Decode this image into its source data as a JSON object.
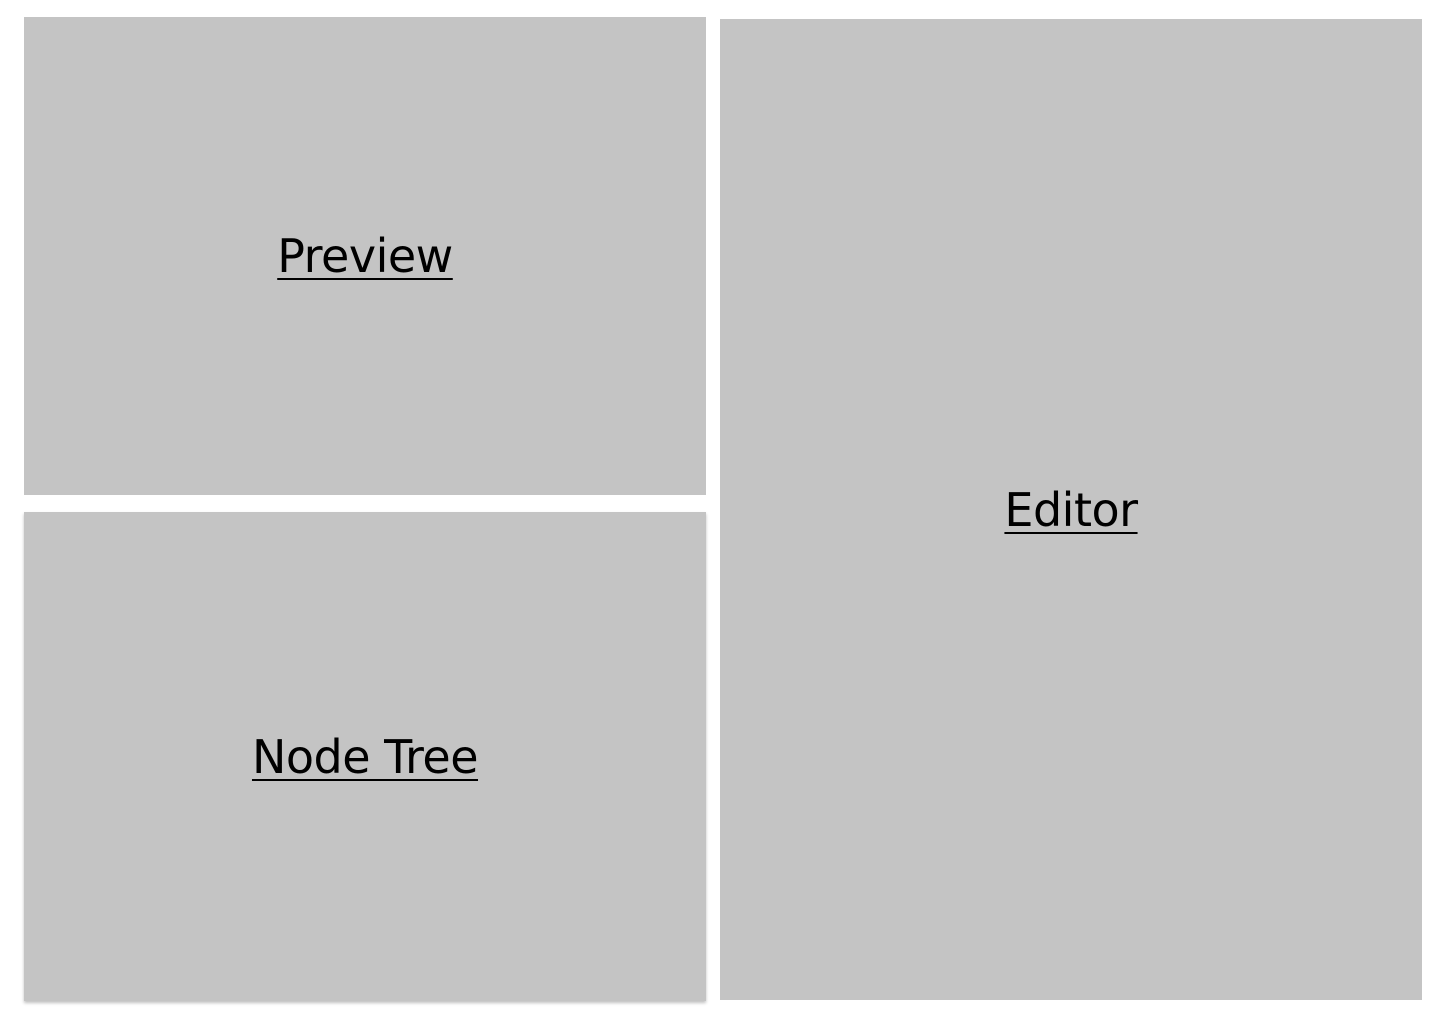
{
  "panels": {
    "preview": {
      "label": "Preview"
    },
    "node_tree": {
      "label": "Node Tree"
    },
    "editor": {
      "label": "Editor"
    }
  },
  "colors": {
    "background": "#ffffff",
    "panel": "#c4c4c4",
    "text": "#000000"
  }
}
